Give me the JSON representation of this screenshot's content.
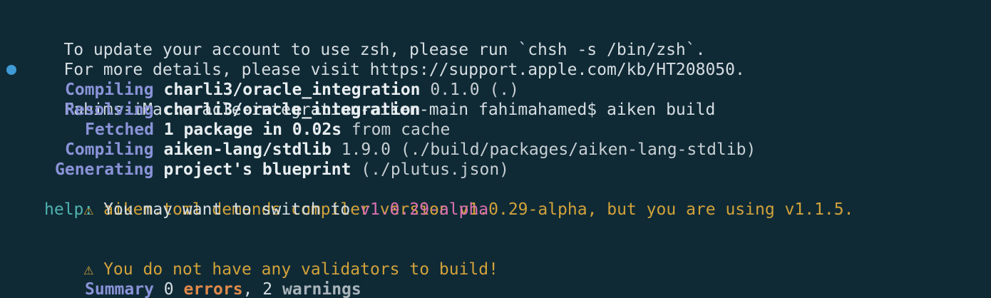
{
  "terminal": {
    "lines": {
      "update_msg": "To update your account to use zsh, please run `chsh -s /bin/zsh`.",
      "details_msg": "For more details, please visit https://support.apple.com/kb/HT208050.",
      "prompt": "Fahims-iMac:oracle-integration-aiken-main fahimahamed$ aiken build"
    },
    "compile1": {
      "verb": "Compiling",
      "pkg": "charli3/oracle_integration",
      "rest": " 0.1.0 (.)"
    },
    "resolve": {
      "verb": "Resolving",
      "pkg": "charli3/oracle_integration"
    },
    "fetched": {
      "verb": "Fetched",
      "pkg": "1 package in 0.02s",
      "rest": " from cache"
    },
    "compile2": {
      "verb": "Compiling",
      "pkg": "aiken-lang/stdlib",
      "rest": " 1.9.0 (./build/packages/aiken-lang-stdlib)"
    },
    "generate": {
      "verb": "Generating",
      "pkg": "project's blueprint",
      "rest": " (./plutus.json)"
    },
    "warning1": "⚠ aiken.toml demands compiler version v1.0.29-alpha, but you are using v1.1.5.",
    "help": {
      "label": "help:",
      "text": " You may want to switch to ",
      "version": "v1.0.29-alpha"
    },
    "warning2": "⚠ You do not have any validators to build!",
    "summary": {
      "verb": "Summary",
      "count1": " 0 ",
      "errors": "errors",
      "sep": ", 2 ",
      "warnings": "warnings"
    }
  },
  "colors": {
    "background": "#0f2a35",
    "verb": "#8a93d8",
    "warning": "#d2a23a",
    "help": "#4fb3b0",
    "version": "#d970b0",
    "errors": "#e0894a",
    "prompt_marker": "#3f9ad6"
  }
}
